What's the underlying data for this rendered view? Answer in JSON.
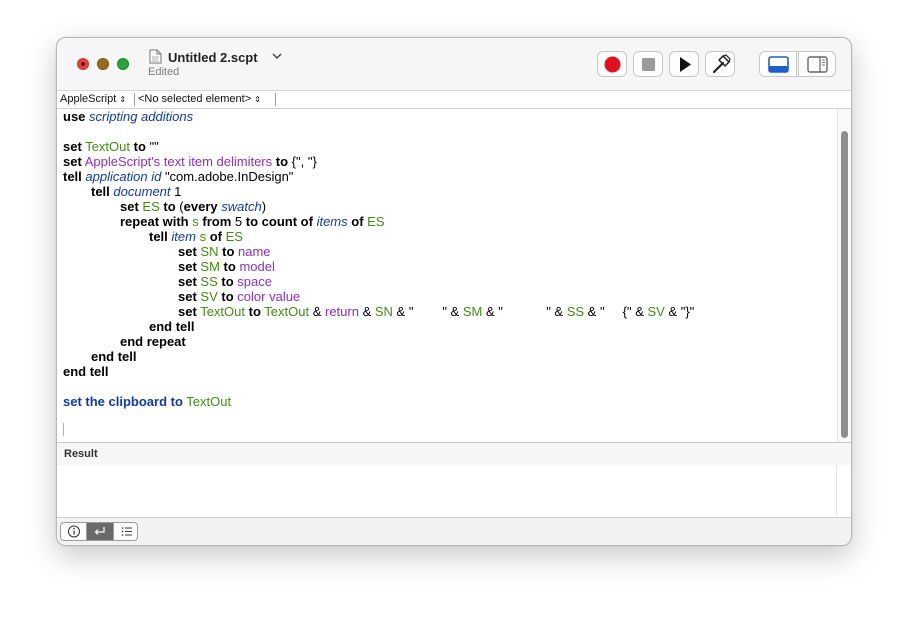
{
  "window": {
    "title": "Untitled 2.scpt",
    "subtitle": "Edited"
  },
  "toolbar": {
    "record_icon": "record-icon",
    "stop_icon": "stop-icon",
    "run_icon": "run-icon",
    "compile_icon": "hammer-icon",
    "view_bottom_icon": "bottom-panel-icon",
    "view_side_icon": "side-panel-icon",
    "colors": {
      "record": "#e0111a",
      "stop": "#9b9b9b",
      "accent": "#1f5fc9"
    }
  },
  "navbar": {
    "language": "AppleScript",
    "element": "<No selected element>"
  },
  "script": {
    "l1": {
      "kw": "use",
      "cls": "scripting additions"
    },
    "l3": {
      "kw1": "set",
      "var": "TextOut",
      "kw2": "to",
      "str": "\"\""
    },
    "l4": {
      "kw1": "set",
      "prop": "AppleScript's text item delimiters",
      "kw2": "to",
      "str": "{\", \"}"
    },
    "l5": {
      "kw": "tell",
      "cls": "application id",
      "str": "\"com.adobe.InDesign\""
    },
    "l6": {
      "kw": "tell",
      "cls": "document",
      "str": "1"
    },
    "l7": {
      "kw1": "set",
      "var": "ES",
      "kw2": "to",
      "p1": "(",
      "kw3": "every",
      "cls": "swatch",
      "p2": ")"
    },
    "l8": {
      "kw1": "repeat with",
      "var": "s",
      "kw2": "from",
      "n": "5",
      "kw3": "to",
      "kw4": "count",
      "kw5": "of",
      "cls": "items",
      "kw6": "of",
      "var2": "ES"
    },
    "l9": {
      "kw1": "tell",
      "cls": "item",
      "var": "s",
      "kw2": "of",
      "var2": "ES"
    },
    "l10": {
      "kw1": "set",
      "var": "SN",
      "kw2": "to",
      "prop": "name"
    },
    "l11": {
      "kw1": "set",
      "var": "SM",
      "kw2": "to",
      "prop": "model"
    },
    "l12": {
      "kw1": "set",
      "var": "SS",
      "kw2": "to",
      "prop": "space"
    },
    "l13": {
      "kw1": "set",
      "var": "SV",
      "kw2": "to",
      "prop": "color value"
    },
    "l14": {
      "kw1": "set",
      "v1": "TextOut",
      "kw2": "to",
      "v2": "TextOut",
      "a1": " & ",
      "prop": "return",
      "a2": " & ",
      "v3": "SN",
      "s1": " & \"        \" & ",
      "v4": "SM",
      "s2": " & \"            \" & ",
      "v5": "SS",
      "s3": " & \"     {\" & ",
      "v6": "SV",
      "s4": " & \"}\""
    },
    "l15": {
      "kw": "end tell"
    },
    "l16": {
      "kw": "end repeat"
    },
    "l17": {
      "kw": "end tell"
    },
    "l18": {
      "kw": "end tell"
    },
    "l20": {
      "kw": "set the clipboard to",
      "var": "TextOut"
    }
  },
  "result": {
    "title": "Result"
  },
  "bottom": {
    "icons": [
      "info-icon",
      "reply-icon",
      "list-icon"
    ]
  }
}
